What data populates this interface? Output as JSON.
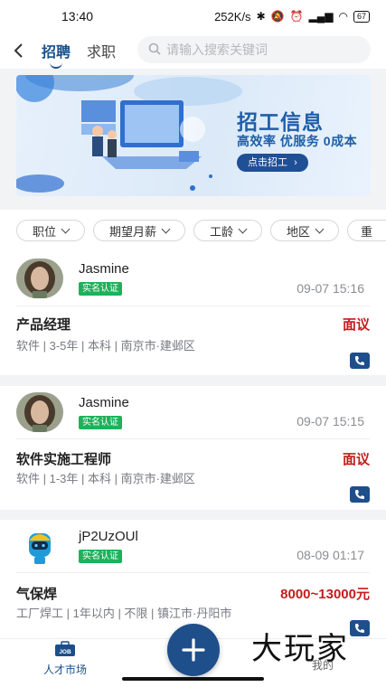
{
  "status": {
    "time": "13:40",
    "speed": "252K/s",
    "battery": "67"
  },
  "header": {
    "tabs": [
      {
        "label": "招聘"
      },
      {
        "label": "求职"
      }
    ]
  },
  "search": {
    "placeholder": "请输入搜索关键词"
  },
  "banner": {
    "title": "招工信息",
    "subtitle": "高效率 优服务 0成本",
    "button": "点击招工"
  },
  "filters": [
    {
      "label": "职位"
    },
    {
      "label": "期望月薪"
    },
    {
      "label": "工龄"
    },
    {
      "label": "地区"
    },
    {
      "label": "重"
    }
  ],
  "jobs": [
    {
      "user": "Jasmine",
      "badge": "实名认证",
      "time": "09-07 15:16",
      "title": "产品经理",
      "salary": "面议",
      "meta": "软件 | 3-5年 | 本科 | 南京市·建邺区"
    },
    {
      "user": "Jasmine",
      "badge": "实名认证",
      "time": "09-07 15:15",
      "title": "软件实施工程师",
      "salary": "面议",
      "meta": "软件 | 1-3年 | 本科 | 南京市·建邺区"
    },
    {
      "user": "jP2UzOUl",
      "badge": "实名认证",
      "time": "08-09 01:17",
      "title": "气保焊",
      "salary": "8000~13000元",
      "meta": "工厂焊工 | 1年以内 | 不限 | 镇江市·丹阳市"
    }
  ],
  "nav": {
    "talent": "人才市场",
    "talent_icon_text": "JOB",
    "mine": "我的"
  },
  "watermark": "大玩家",
  "colors": {
    "brand": "#1f4f8b",
    "badge": "#1cb25b",
    "salary": "#c41d1d"
  }
}
